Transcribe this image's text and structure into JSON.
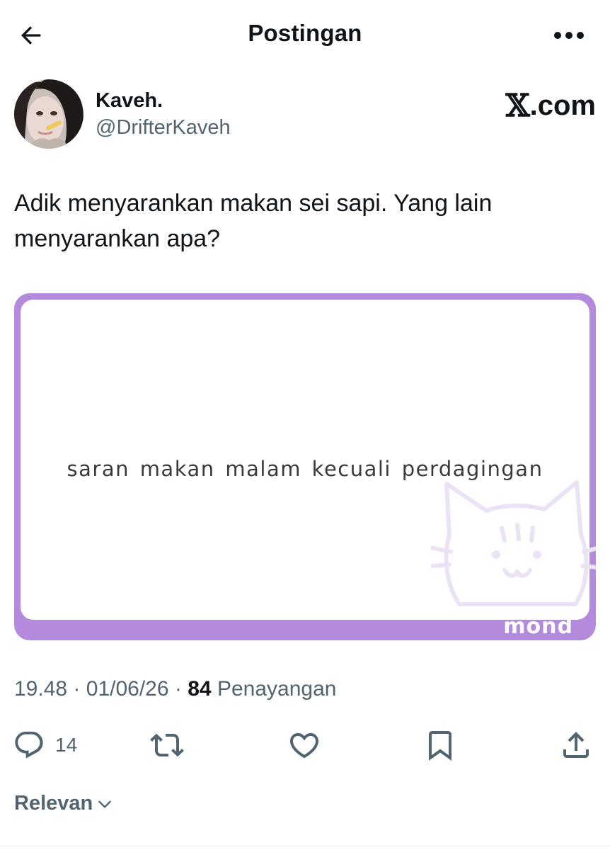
{
  "header": {
    "title": "Postingan",
    "back_icon": "arrow-left-icon",
    "more_icon": "more-horizontal-icon"
  },
  "post": {
    "author": {
      "display_name": "Kaveh.",
      "handle": "@DrifterKaveh",
      "avatar_icon": "avatar"
    },
    "brand": {
      "x_glyph": "𝕏",
      "rest": ".com"
    },
    "text": "Adik menyarankan makan sei sapi. Yang lain menyarankan apa?",
    "media": {
      "caption": "saran makan malam kecuali perdagingan",
      "watermark": "mond",
      "frame_color": "#b48bdc"
    },
    "meta": {
      "time": "19.48",
      "separator": "·",
      "date": "01/06/26",
      "views_count": "84",
      "views_label": "Penayangan"
    },
    "actions": {
      "reply_count": "14",
      "reply_icon": "reply-icon",
      "repost_icon": "repost-icon",
      "like_icon": "heart-icon",
      "bookmark_icon": "bookmark-icon",
      "share_icon": "share-icon"
    }
  },
  "replies_filter": {
    "label": "Relevan",
    "icon": "chevron-down-icon"
  },
  "colors": {
    "text_primary": "#0f1419",
    "text_secondary": "#536471",
    "media_frame": "#b48bdc"
  }
}
